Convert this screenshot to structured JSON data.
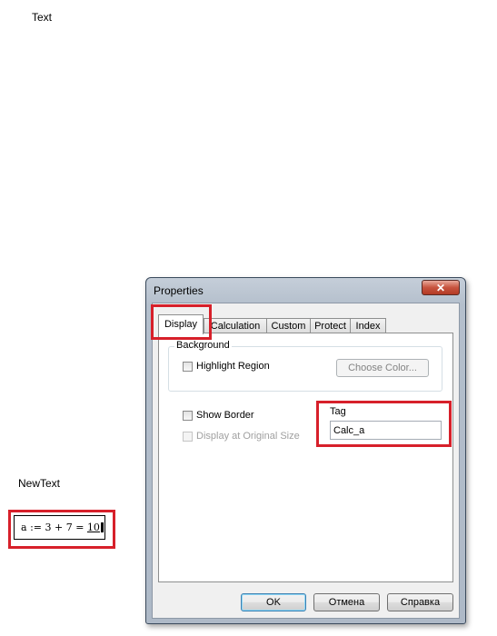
{
  "worksheet": {
    "text_label": "Text",
    "newtext_label": "NewText",
    "math_expression": {
      "lhs": "a",
      "define_op": ":=",
      "expr": "3 + 7",
      "eval_op": "=",
      "result": "10"
    }
  },
  "dialog": {
    "title": "Properties",
    "close_glyph": "✕",
    "tabs": [
      {
        "label": "Display",
        "active": true
      },
      {
        "label": "Calculation",
        "active": false
      },
      {
        "label": "Custom",
        "active": false
      },
      {
        "label": "Protect",
        "active": false
      },
      {
        "label": "Index",
        "active": false
      }
    ],
    "background_group": {
      "label": "Background",
      "highlight_region": {
        "label": "Highlight Region",
        "checked": false
      },
      "choose_color_button": {
        "label": "Choose Color...",
        "enabled": false
      }
    },
    "show_border": {
      "label": "Show Border",
      "checked": false
    },
    "display_original_size": {
      "label": "Display at Original Size",
      "checked": false,
      "enabled": false
    },
    "tag": {
      "label": "Tag",
      "value": "Calc_a"
    },
    "buttons": {
      "ok": "OK",
      "cancel": "Отмена",
      "help": "Справка"
    }
  },
  "colors": {
    "highlight_box": "#d7202a",
    "close_button": "#c7533e"
  }
}
